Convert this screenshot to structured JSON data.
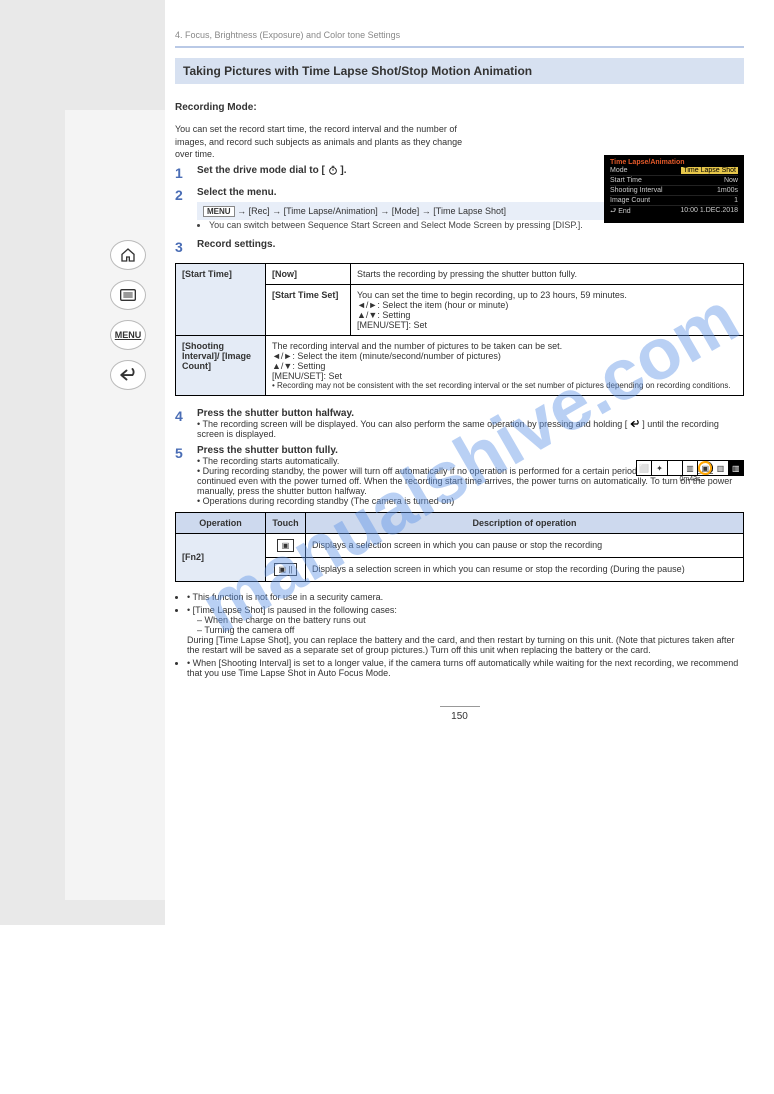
{
  "watermark": "manualshive.com",
  "nav": {
    "home": "home-icon",
    "list": "list-icon",
    "menu": "MENU",
    "back": "back-icon"
  },
  "breadcrumb": "4. Focus, Brightness (Exposure) and Color tone Settings",
  "heading_image_drive": "Taking Pictures with Time Lapse Shot/Stop Motion Animation",
  "rec_mode_label": "Recording Mode:",
  "rec_modes": "",
  "body_p1": "You can set the record start time, the record interval and the number of images, and record such subjects as animals and plants as they change over time.",
  "step1": {
    "num": "1",
    "text_a": "Set the drive mode dial to [",
    "text_b": "]."
  },
  "step2": {
    "num": "2",
    "text_a": "Select the menu.",
    "menu_btn": "MENU",
    "chain": " → [Rec] → [Time Lapse/Animation] → [Mode] → [Time Lapse Shot]"
  },
  "step2_bullet": "You can switch between Sequence Start Screen and Select Mode Screen by pressing [DISP.].",
  "step3": {
    "num": "3",
    "text": "Record settings."
  },
  "lcd": {
    "title": "Time Lapse/Animation",
    "rows": [
      {
        "k": "Mode",
        "v": "Time Lapse Shot"
      },
      {
        "k": "Start Time",
        "v": "Now"
      },
      {
        "k": "Shooting Interval",
        "v": "1m00s"
      },
      {
        "k": "Image Count",
        "v": "1"
      }
    ],
    "footer_left": "⮐ End",
    "footer_right": "10:00  1.DEC.2018"
  },
  "table1": {
    "r1": {
      "c1": "[Start Time]",
      "c2": "[Now]",
      "c3": "Starts the recording by pressing the shutter button fully."
    },
    "r2": {
      "c2": "[Start Time Set]",
      "c3_a": "You can set the time to begin recording, up to 23 hours, 59 minutes.",
      "c3_b": "◄/►: Select the item (hour or minute)",
      "c3_c": "▲/▼: Setting",
      "c3_d": "[MENU/SET]: Set"
    },
    "r3": {
      "c1": "[Shooting Interval]/ [Image Count]",
      "c3_a": "The recording interval and the number of pictures to be taken can be set.",
      "c3_b": "◄/►: Select the item (minute/second/number of pictures)",
      "c3_c": "▲/▼: Setting",
      "c3_d": "[MENU/SET]: Set",
      "c3_e": "• Recording may not be consistent with the set recording interval or the set number of pictures depending on recording conditions."
    }
  },
  "step4": {
    "num": "4",
    "text_a": "Press the shutter button halfway.",
    "bullet": "• The recording screen will be displayed. You can also perform the same operation by pressing and holding [",
    "text_b": "] until the recording screen is displayed."
  },
  "step5": {
    "num": "5",
    "text": "Press the shutter button fully.",
    "b1": "• The recording starts automatically.",
    "b2": "• During recording standby, the power will turn off automatically if no operation is performed for a certain period. The Time Lapse Shot is continued even with the power turned off. When the recording start time arrives, the power turns on automatically. To turn on the power manually, press the shutter button halfway.",
    "b3": "• Operations during recording standby (The camera is turned on)"
  },
  "table2": {
    "h1": "Operation",
    "h2": "Touch",
    "h3": "Description of operation",
    "r1": {
      "op": "[Fn2]",
      "icon": "▣",
      "desc": "Displays a selection screen in which you can pause or stop the recording"
    },
    "r2": {
      "icon": "▣ ||",
      "desc": "Displays a selection screen in which you can resume or stop the recording (During the pause)"
    }
  },
  "notes": {
    "n1": "• This function is not for use in a security camera.",
    "n2": "• [Time Lapse Shot] is paused in the following cases:",
    "n2a": "– When the charge on the battery runs out",
    "n2b": "– Turning the camera off",
    "n2c": "During [Time Lapse Shot], you can replace the battery and the card, and then restart by turning on this unit. (Note that pictures taken after the restart will be saved as a separate set of group pictures.) Turn off this unit when replacing the battery or the card.",
    "n3": "• When [Shooting Interval] is set to a longer value, if the camera turns off automatically while waiting for the next recording, we recommend that you use Time Lapse Shot in Auto Focus Mode."
  },
  "page_num": "150"
}
